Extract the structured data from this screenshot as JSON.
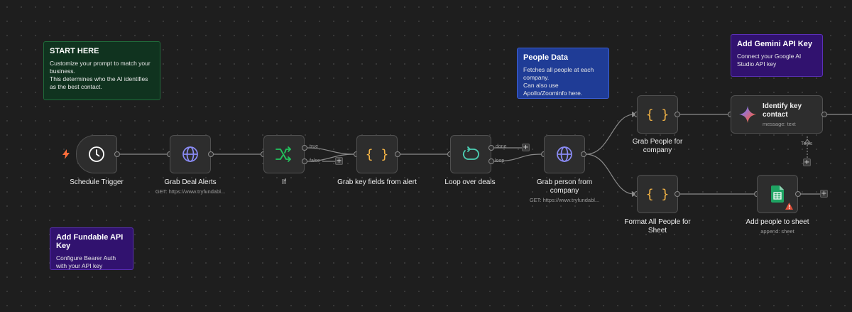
{
  "notes": {
    "start": {
      "title": "START HERE",
      "lines": [
        "Customize your prompt to match your business.",
        "This determines who the AI identifies as the best contact."
      ]
    },
    "people": {
      "title": "People Data",
      "lines": [
        "Fetches all people at each company.",
        "Can also use Apollo/Zoominfo here."
      ]
    },
    "gemini": {
      "title": "Add Gemini API Key",
      "lines": [
        "Connect your Google AI Studio API key"
      ]
    },
    "fundable": {
      "title": "Add Fundable API Key",
      "lines": [
        "Configure Bearer Auth with your API key"
      ]
    }
  },
  "nodes": {
    "schedule": {
      "label": "Schedule Trigger",
      "icon": "clock-icon"
    },
    "deal_alerts": {
      "label": "Grab Deal Alerts",
      "sub": "GET: https://www.tryfundabl...",
      "icon": "globe-icon"
    },
    "if_node": {
      "label": "If",
      "icon": "branch-icon",
      "out_true": "true",
      "out_false": "false"
    },
    "key_fields": {
      "label": "Grab key fields from alert",
      "icon": "braces-icon"
    },
    "loop": {
      "label": "Loop over deals",
      "icon": "loop-icon",
      "out_done": "done",
      "out_loop": "loop"
    },
    "person": {
      "label": "Grab person from company",
      "sub": "GET: https://www.tryfundabl...",
      "icon": "globe-icon"
    },
    "grab_people": {
      "label": "Grab People for company",
      "icon": "braces-icon"
    },
    "format_people": {
      "label": "Format All People for Sheet",
      "icon": "braces-icon"
    },
    "identify": {
      "title": "Identify key contact",
      "sub": "message: text",
      "tools": "Tools",
      "icon": "gemini-icon"
    },
    "sheet": {
      "label": "Add people to sheet",
      "sub": "append: sheet",
      "icon": "sheets-icon"
    }
  },
  "plus_glyph": "+",
  "colors": {
    "canvas": "#1e1e1e",
    "node": "#2d2d2d",
    "edge": "#8a8a8a",
    "trigger_bolt": "#ff6d3a",
    "globe": "#8b8cf6",
    "branch": "#22c55e",
    "braces": "#f4b446",
    "loop": "#4dd0b5",
    "warning": "#e2513c"
  }
}
